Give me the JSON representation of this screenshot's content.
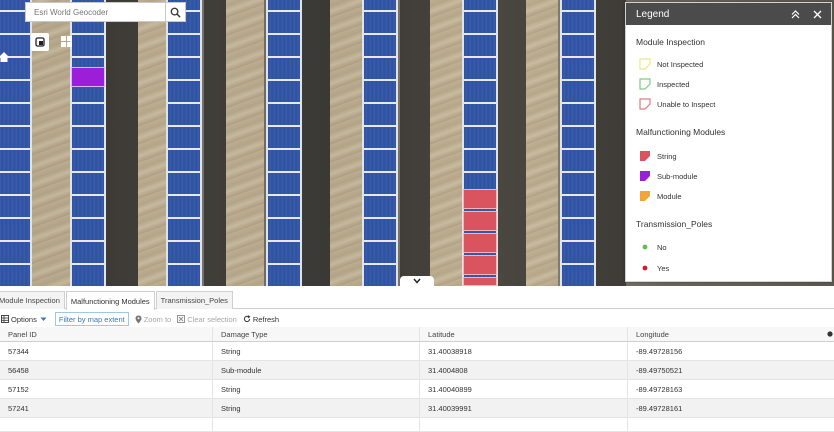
{
  "search": {
    "placeholder": "Esri World Geocoder"
  },
  "legend": {
    "title": "Legend",
    "groups": [
      {
        "title": "Module Inspection",
        "items": [
          {
            "label": "Not Inspected",
            "color": "#f3f3b0"
          },
          {
            "label": "Inspected",
            "color": "#9ad69a"
          },
          {
            "label": "Unable to Inspect",
            "color": "#e6a0a6"
          }
        ]
      },
      {
        "title": "Malfunctioning Modules",
        "items": [
          {
            "label": "String",
            "color": "#d9545f"
          },
          {
            "label": "Sub-module",
            "color": "#9c1ed8"
          },
          {
            "label": "Module",
            "color": "#f2a63a"
          }
        ]
      },
      {
        "title": "Transmission_Poles",
        "items": [
          {
            "label": "No",
            "color": "#5cc04a"
          },
          {
            "label": "Yes",
            "color": "#d8182c"
          }
        ]
      }
    ]
  },
  "tabs": [
    {
      "label": "Module Inspection"
    },
    {
      "label": "Malfunctioning Modules"
    },
    {
      "label": "Transmission_Poles"
    }
  ],
  "toolbar": {
    "options": "Options",
    "filter": "Filter by map extent",
    "zoom": "Zoom to",
    "clear": "Clear selection",
    "refresh": "Refresh"
  },
  "table": {
    "headers": [
      "Panel ID",
      "Damage Type",
      "Latitude",
      "Longitude"
    ],
    "rows": [
      [
        "57344",
        "String",
        "31.40038918",
        "-89.49728156"
      ],
      [
        "56458",
        "Sub-module",
        "31.4004808",
        "-89.49750521"
      ],
      [
        "57152",
        "String",
        "31.40040899",
        "-89.49728163"
      ],
      [
        "57241",
        "String",
        "31.40039991",
        "-89.49728161"
      ]
    ]
  }
}
